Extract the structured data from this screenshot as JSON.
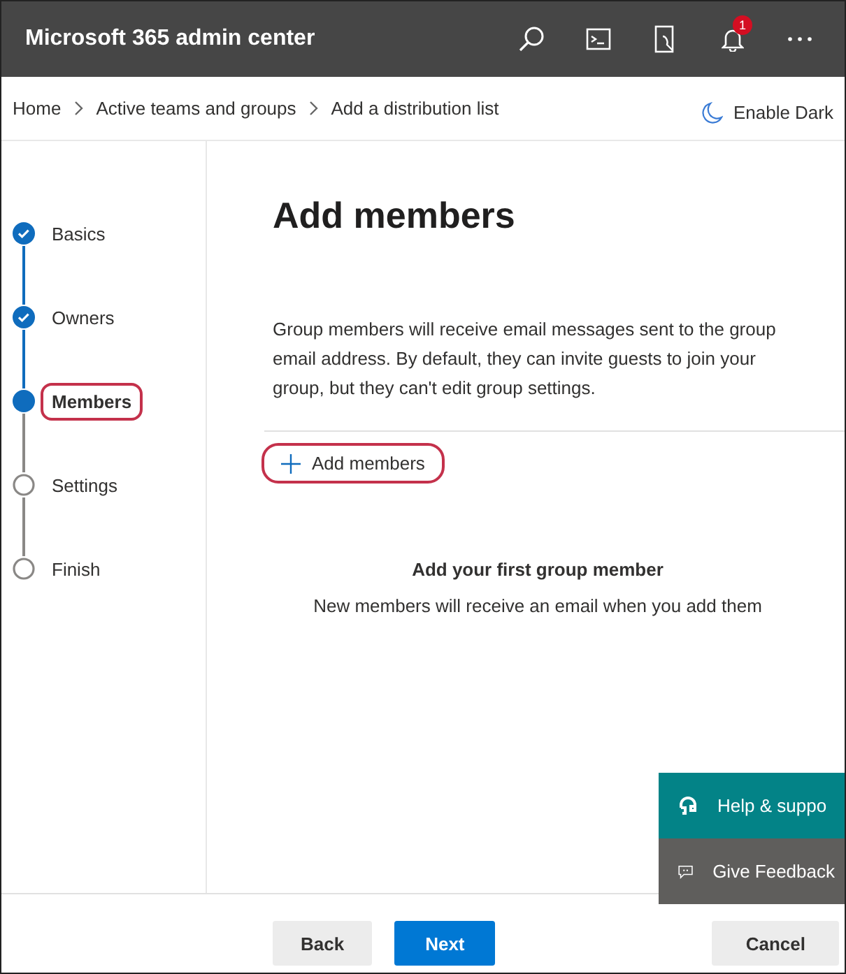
{
  "header": {
    "title": "Microsoft 365 admin center",
    "notification_count": "1"
  },
  "breadcrumb": [
    "Home",
    "Active teams and groups",
    "Add a distribution list"
  ],
  "theme_toggle": {
    "label": "Enable Dark"
  },
  "steps": [
    {
      "label": "Basics",
      "kind": "done",
      "selected": false,
      "highlighted": false
    },
    {
      "label": "Owners",
      "kind": "done",
      "selected": false,
      "highlighted": false
    },
    {
      "label": "Members",
      "kind": "current",
      "selected": true,
      "highlighted": true
    },
    {
      "label": "Settings",
      "kind": "pending",
      "selected": false,
      "highlighted": false
    },
    {
      "label": "Finish",
      "kind": "pending",
      "selected": false,
      "highlighted": false
    }
  ],
  "main": {
    "heading": "Add members",
    "description": "Group members will receive email messages sent to the group email address. By default, they can invite guests to join your group, but they can't edit group settings.",
    "add_button": {
      "label": "Add members",
      "highlighted": true
    },
    "empty_title": "Add your first group member",
    "empty_text": "New members will receive an email when you add them"
  },
  "help_panel": [
    {
      "kind": "help",
      "label": "Help & suppo"
    },
    {
      "kind": "feedback",
      "label": "Give Feedback"
    }
  ],
  "footer": {
    "buttons": [
      {
        "label": "Back",
        "kind": "secondary"
      },
      {
        "label": "Next",
        "kind": "primary"
      },
      {
        "label": "Cancel",
        "kind": "secondary"
      }
    ]
  }
}
